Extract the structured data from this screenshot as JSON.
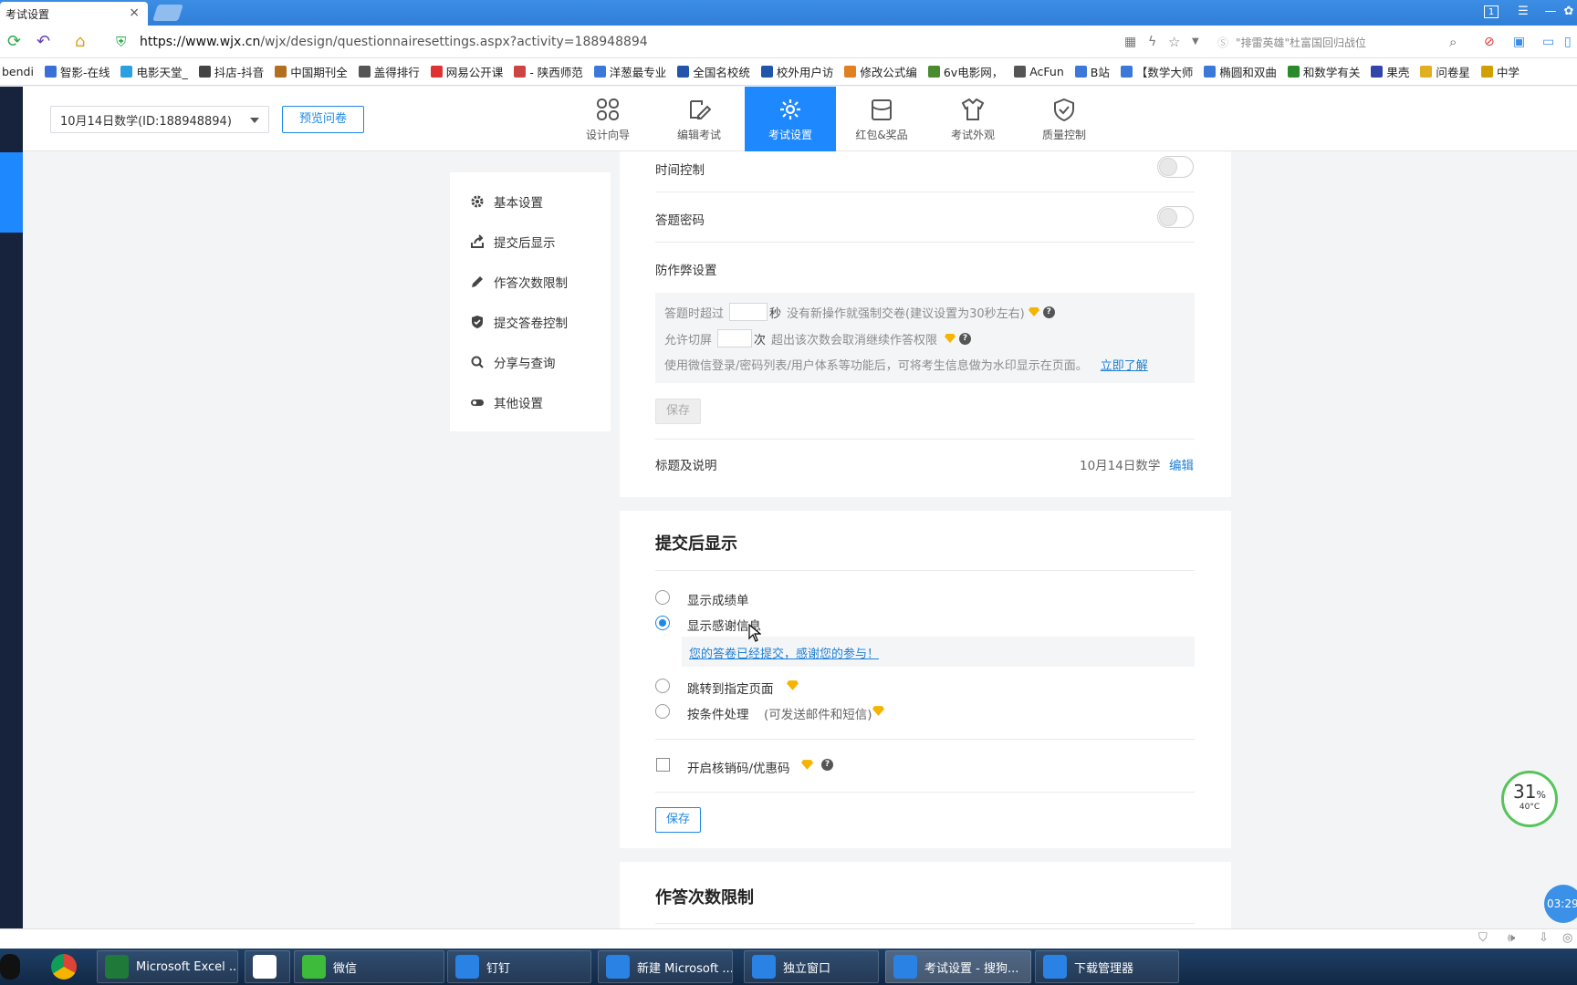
{
  "browser": {
    "tab_title": "考试设置",
    "tab_close": "×",
    "url_host": "https://www.wjx.cn",
    "url_path": "/wjx/design/questionnairesettings.aspx?activity=188948894",
    "search_placeholder": "\"排雷英雄\"杜富国回归战位",
    "window_badge": "1"
  },
  "bookmarks": [
    {
      "label": "bendi",
      "color": "#f0a030"
    },
    {
      "label": "智影-在线",
      "color": "#3b6fd8"
    },
    {
      "label": "电影天堂_",
      "color": "#2aa0e0"
    },
    {
      "label": "抖店-抖音",
      "color": "#444"
    },
    {
      "label": "中国期刊全",
      "color": "#b07020"
    },
    {
      "label": "盖得排行",
      "color": "#555"
    },
    {
      "label": "网易公开课",
      "color": "#d33"
    },
    {
      "label": "- 陕西师范",
      "color": "#c44"
    },
    {
      "label": "洋葱最专业",
      "color": "#3c78d8"
    },
    {
      "label": "全国名校统",
      "color": "#2255aa"
    },
    {
      "label": "校外用户访",
      "color": "#2255aa"
    },
    {
      "label": "修改公式编",
      "color": "#e08020"
    },
    {
      "label": "6v电影网，",
      "color": "#4a8a30"
    },
    {
      "label": "AcFun",
      "color": "#555"
    },
    {
      "label": "B站",
      "color": "#3c78d8"
    },
    {
      "label": "【数学大师",
      "color": "#3c78d8"
    },
    {
      "label": "椭圆和双曲",
      "color": "#3c78d8"
    },
    {
      "label": "和数学有关",
      "color": "#2a8a2a"
    },
    {
      "label": "果壳",
      "color": "#3344aa"
    },
    {
      "label": "问卷星",
      "color": "#e0b020"
    },
    {
      "label": "中学",
      "color": "#d0a000"
    }
  ],
  "header": {
    "survey_select": "10月14日数学(ID:188948894)",
    "preview_button": "预览问卷",
    "tabs": [
      {
        "label": "设计向导",
        "icon": "grid-icon"
      },
      {
        "label": "编辑考试",
        "icon": "edit-icon"
      },
      {
        "label": "考试设置",
        "icon": "gear-icon",
        "active": true
      },
      {
        "label": "红包&奖品",
        "icon": "gift-icon"
      },
      {
        "label": "考试外观",
        "icon": "shirt-icon"
      },
      {
        "label": "质量控制",
        "icon": "shield-check-icon"
      }
    ]
  },
  "left_menu": [
    {
      "label": "基本设置",
      "icon": "gear-icon"
    },
    {
      "label": "提交后显示",
      "icon": "share-icon"
    },
    {
      "label": "作答次数限制",
      "icon": "pencil-icon"
    },
    {
      "label": "提交答卷控制",
      "icon": "shield-icon"
    },
    {
      "label": "分享与查询",
      "icon": "search-icon"
    },
    {
      "label": "其他设置",
      "icon": "toggle-icon"
    }
  ],
  "basic": {
    "time_control": "时间控制",
    "answer_password": "答题密码",
    "anticheat_title": "防作弊设置",
    "line1_prefix": "答题时超过",
    "line1_unit": "秒",
    "line1_suffix": "没有新操作就强制交卷(建议设置为30秒左右)",
    "line2_prefix": "允许切屏",
    "line2_unit": "次",
    "line2_suffix": "超出该次数会取消继续作答权限",
    "line3_text": "使用微信登录/密码列表/用户体系等功能后，可将考生信息做为水印显示在页面。",
    "line3_link": "立即了解",
    "save": "保存",
    "title_label": "标题及说明",
    "title_value": "10月14日数学",
    "title_edit": "编辑"
  },
  "after_submit": {
    "title": "提交后显示",
    "options": [
      {
        "label": "显示成绩单",
        "selected": false
      },
      {
        "label": "显示感谢信息",
        "selected": true
      },
      {
        "label": "跳转到指定页面",
        "selected": false
      },
      {
        "label": "按条件处理",
        "sub": "(可发送邮件和短信)",
        "selected": false
      }
    ],
    "thanks_message": "您的答卷已经提交，感谢您的参与！",
    "coupon_label": "开启核销码/优惠码",
    "save": "保存"
  },
  "attempt_limit": {
    "title": "作答次数限制"
  },
  "widgets": {
    "perf_percent": "31",
    "perf_unit": "%",
    "perf_temp": "40°C",
    "clock": "03:29"
  },
  "taskbar": [
    {
      "label": "",
      "color": "#2f9f3a"
    },
    {
      "label": "Microsoft Excel ...",
      "color": "#1f7a3a"
    },
    {
      "label": "",
      "color": "#ffffff"
    },
    {
      "label": "微信",
      "color": "#3dbb3a"
    },
    {
      "label": "钉钉",
      "color": "#2a82e4"
    },
    {
      "label": "新建 Microsoft ...",
      "color": "#2a82e4"
    },
    {
      "label": "独立窗口",
      "color": "#2a82e4"
    },
    {
      "label": "考试设置 - 搜狗...",
      "color": "#2a82e4"
    },
    {
      "label": "下载管理器",
      "color": "#2a82e4"
    }
  ]
}
